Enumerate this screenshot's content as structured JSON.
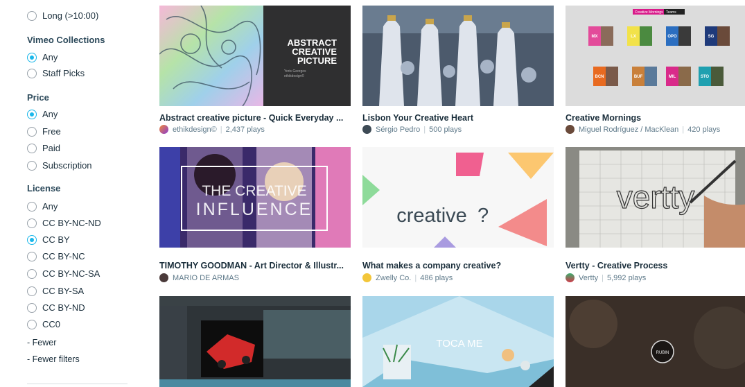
{
  "filters": {
    "length_long": "Long (>10:00)",
    "collections": {
      "heading": "Vimeo Collections",
      "options": [
        "Any",
        "Staff Picks"
      ]
    },
    "price": {
      "heading": "Price",
      "options": [
        "Any",
        "Free",
        "Paid",
        "Subscription"
      ]
    },
    "license": {
      "heading": "License",
      "options": [
        "Any",
        "CC BY-NC-ND",
        "CC BY",
        "CC BY-NC",
        "CC BY-NC-SA",
        "CC BY-SA",
        "CC BY-ND",
        "CC0"
      ]
    },
    "fewer": "- Fewer",
    "fewer_filters": "- Fewer filters"
  },
  "videos": [
    {
      "title": "Abstract creative picture - Quick Everyday ...",
      "user": "ethikdesign©",
      "plays": "2,437 plays",
      "thumb_text": {
        "line1": "ABSTRACT",
        "line2": "CREATIVE",
        "line3": "PICTURE",
        "small": "Yoris Georges",
        "small2": "ethikdesign©"
      }
    },
    {
      "title": "Lisbon Your Creative Heart",
      "user": "Sérgio Pedro",
      "plays": "500 plays"
    },
    {
      "title": "Creative Mornings",
      "user": "Miguel Rodríguez / MacKlean",
      "plays": "420 plays",
      "thumb_text": {
        "banner1": "Creative Mornings",
        "banner2": "Teams",
        "cities": [
          "MX",
          "LX",
          "OPO",
          "SG",
          "BCN",
          "BUF",
          "MIL",
          "STO"
        ]
      }
    },
    {
      "title": "TIMOTHY GOODMAN - Art Director & Illustr...",
      "user": "MARIO DE ARMAS",
      "plays": "",
      "thumb_text": {
        "line1": "THE CREATIVE",
        "line2": "INFLUENCE"
      }
    },
    {
      "title": "What makes a company creative?",
      "user": "Zwelly Co.",
      "plays": "486 plays",
      "thumb_text": {
        "word": "creative",
        "mark": "?"
      }
    },
    {
      "title": "Vertty - Creative Process",
      "user": "Vertty",
      "plays": "5,992 plays",
      "thumb_text": {
        "word": "vertty"
      }
    },
    {
      "title": "",
      "user": "",
      "plays": ""
    },
    {
      "title": "",
      "user": "",
      "plays": "",
      "thumb_text": {
        "word": "TOCA ME"
      }
    },
    {
      "title": "",
      "user": "",
      "plays": "",
      "thumb_text": {
        "word": "RUBIN"
      }
    }
  ],
  "colors": {
    "accent": "#1ab7ea",
    "title": "#1a2e3b",
    "meta": "#5f7a8a"
  }
}
